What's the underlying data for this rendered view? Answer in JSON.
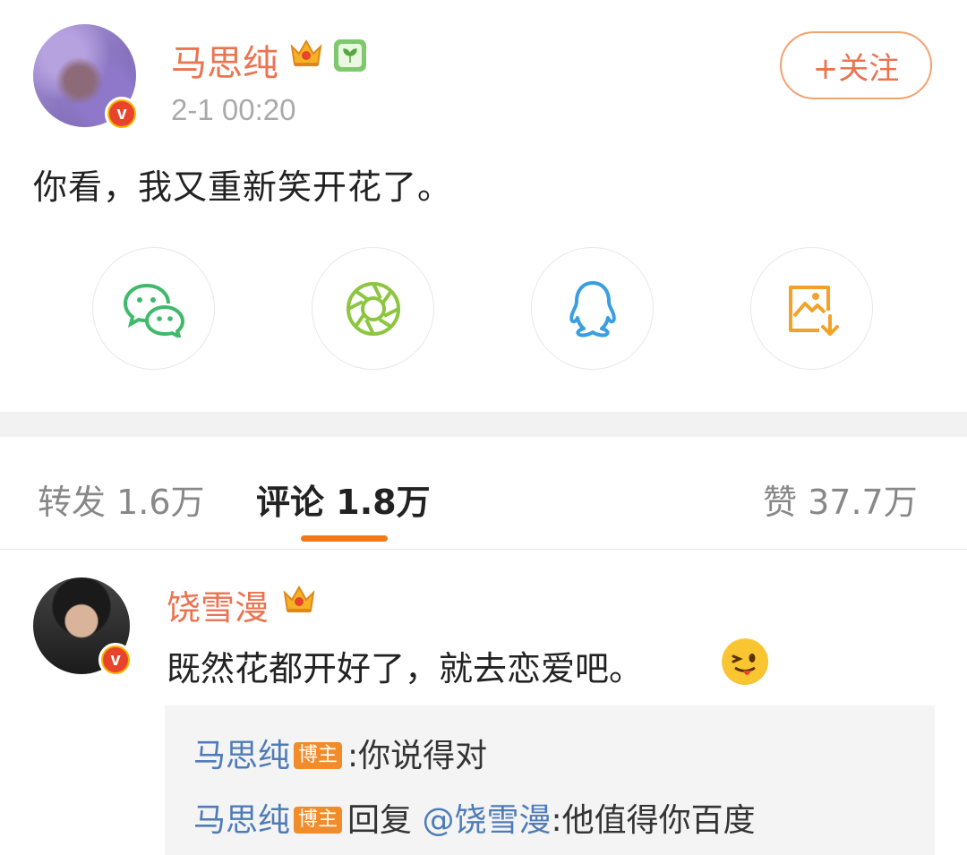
{
  "post": {
    "author": "马思纯",
    "time": "2-1 00:20",
    "follow_label": "+关注",
    "text": "你看，我又重新笑开花了。"
  },
  "share": {
    "items": [
      {
        "icon": "wechat-icon",
        "color": "#3fba6a"
      },
      {
        "icon": "moments-icon",
        "color": "#8cc63f"
      },
      {
        "icon": "qq-icon",
        "color": "#3a9ee0"
      },
      {
        "icon": "save-image-icon",
        "color": "#f3a12b"
      }
    ]
  },
  "tabs": {
    "repost_label": "转发",
    "repost_count": "1.6万",
    "comment_label": "评论",
    "comment_count": "1.8万",
    "like_label": "赞",
    "like_count": "37.7万"
  },
  "comment": {
    "author": "饶雪漫",
    "text": "既然花都开好了，就去恋爱吧。",
    "replies": [
      {
        "name": "马思纯",
        "badge": "博主",
        "prefix": ":",
        "text": "你说得对"
      },
      {
        "name": "马思纯",
        "badge": "博主",
        "reply_word": "回复",
        "mention": "@饶雪漫",
        "text": ":他值得你百度"
      }
    ]
  },
  "colors": {
    "accent": "#eb7350",
    "link": "#4f7cb8",
    "tab_indicator": "#f07a1b"
  }
}
